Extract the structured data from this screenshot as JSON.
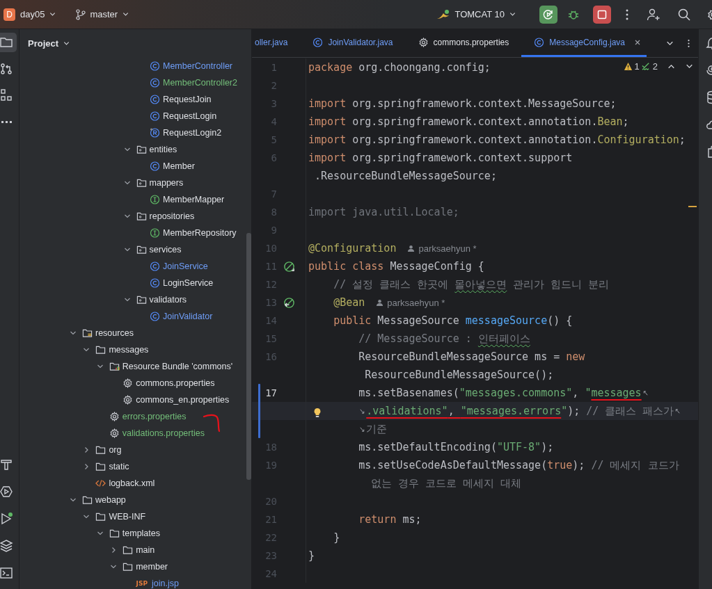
{
  "toolbar": {
    "project": {
      "initial": "D",
      "name": "day05"
    },
    "branch": "master",
    "run_config": "TOMCAT 10"
  },
  "left_tools": [
    {
      "kind": "project",
      "selected": true
    },
    {
      "kind": "commit",
      "selected": false
    },
    {
      "kind": "structure",
      "selected": false
    },
    {
      "kind": "more",
      "selected": false
    }
  ],
  "left_tools_bottom": [
    {
      "kind": "build",
      "selected": false
    },
    {
      "kind": "services",
      "selected": false
    },
    {
      "kind": "run",
      "selected": false
    },
    {
      "kind": "layers",
      "selected": false
    },
    {
      "kind": "terminal",
      "selected": false
    }
  ],
  "project_panel": {
    "title": "Project",
    "tree": [
      {
        "children": [
          {
            "children": [
              {
                "children": [
                  {
                    "children": [
                      {
                        "children": [
                          {
                            "label": "MemberController",
                            "kind": "class",
                            "color": "#6f9ef8"
                          },
                          {
                            "label": "MemberController2",
                            "kind": "class",
                            "color": "#73bd79"
                          },
                          {
                            "label": "RequestJoin",
                            "kind": "class",
                            "color": "#dfe1e5"
                          },
                          {
                            "label": "RequestLogin",
                            "kind": "class",
                            "color": "#dfe1e5"
                          },
                          {
                            "label": "RequestLogin2",
                            "kind": "record",
                            "color": "#dfe1e5"
                          }
                        ]
                      },
                      {
                        "label": "entities",
                        "kind": "package",
                        "color": "#dfe1e5",
                        "expanded": true,
                        "children": [
                          {
                            "label": "Member",
                            "kind": "class",
                            "color": "#dfe1e5"
                          }
                        ]
                      },
                      {
                        "label": "mappers",
                        "kind": "package",
                        "color": "#dfe1e5",
                        "expanded": true,
                        "children": [
                          {
                            "label": "MemberMapper",
                            "kind": "interface",
                            "color": "#dfe1e5"
                          }
                        ]
                      },
                      {
                        "label": "repositories",
                        "kind": "package",
                        "color": "#dfe1e5",
                        "expanded": true,
                        "children": [
                          {
                            "label": "MemberRepository",
                            "kind": "interface",
                            "color": "#dfe1e5"
                          }
                        ]
                      },
                      {
                        "label": "services",
                        "kind": "package",
                        "color": "#dfe1e5",
                        "expanded": true,
                        "children": [
                          {
                            "label": "JoinService",
                            "kind": "class",
                            "color": "#6f9ef8"
                          },
                          {
                            "label": "LoginService",
                            "kind": "class",
                            "color": "#dfe1e5"
                          }
                        ]
                      },
                      {
                        "label": "validators",
                        "kind": "package",
                        "color": "#dfe1e5",
                        "expanded": true,
                        "children": [
                          {
                            "label": "JoinValidator",
                            "kind": "class",
                            "color": "#6f9ef8"
                          }
                        ]
                      }
                    ]
                  }
                ]
              }
            ]
          }
        ]
      },
      {
        "label": "resources",
        "kind": "resources",
        "color": "#dfe1e5",
        "expanded": true,
        "children": [
          {
            "label": "messages",
            "kind": "folder",
            "color": "#dfe1e5",
            "expanded": true,
            "children": [
              {
                "label": "Resource Bundle 'commons'",
                "kind": "bundle",
                "color": "#dfe1e5",
                "expanded": true,
                "children": [
                  {
                    "label": "commons.properties",
                    "kind": "properties",
                    "color": "#dfe1e5"
                  },
                  {
                    "label": "commons_en.properties",
                    "kind": "properties",
                    "color": "#dfe1e5"
                  }
                ]
              },
              {
                "label": "errors.properties",
                "kind": "properties",
                "color": "#73bd79"
              },
              {
                "label": "validations.properties",
                "kind": "properties",
                "color": "#73bd79"
              }
            ]
          },
          {
            "label": "org",
            "kind": "folder",
            "color": "#dfe1e5",
            "expanded": false
          },
          {
            "label": "static",
            "kind": "folder",
            "color": "#dfe1e5",
            "expanded": false
          },
          {
            "label": "logback.xml",
            "kind": "xml",
            "color": "#dfe1e5"
          }
        ]
      },
      {
        "label": "webapp",
        "kind": "folder",
        "color": "#dfe1e5",
        "expanded": true,
        "children": [
          {
            "label": "WEB-INF",
            "kind": "folder",
            "color": "#dfe1e5",
            "expanded": true,
            "children": [
              {
                "label": "templates",
                "kind": "folder",
                "color": "#dfe1e5",
                "expanded": true,
                "children": [
                  {
                    "label": "main",
                    "kind": "folder",
                    "color": "#dfe1e5",
                    "expanded": false
                  },
                  {
                    "label": "member",
                    "kind": "folder",
                    "color": "#dfe1e5",
                    "expanded": true,
                    "children": [
                      {
                        "label": "join.jsp",
                        "kind": "jsp",
                        "icon_text": "JSP",
                        "color": "#6f9ef8"
                      }
                    ]
                  }
                ]
              }
            ]
          }
        ]
      }
    ]
  },
  "tabs": [
    {
      "label": "oller.java",
      "color": "#6f9ef8",
      "selected": false
    },
    {
      "label": "JoinValidator.java",
      "kind": "class",
      "color": "#6f9ef8",
      "selected": false
    },
    {
      "label": "commons.properties",
      "kind": "properties",
      "color": "#dfe1e5",
      "selected": false
    },
    {
      "label": "MessageConfig.java",
      "kind": "class",
      "color": "#6f9ef8",
      "selected": true
    }
  ],
  "editor": {
    "warnings": "1",
    "checks": "2",
    "lines": [
      {
        "number": "1",
        "kind": "plain",
        "rows": [
          {
            "tokens": [
              {
                "kind": "kw",
                "text": "package "
              },
              {
                "kind": "plain",
                "text": "org.choongang.config;"
              }
            ]
          }
        ]
      },
      {
        "number": "2",
        "kind": "plain",
        "rows": [
          {}
        ]
      },
      {
        "number": "3",
        "kind": "plain",
        "rows": [
          {
            "tokens": [
              {
                "kind": "kw",
                "text": "import "
              },
              {
                "kind": "plain",
                "text": "org.springframework.context.MessageSource;"
              }
            ]
          }
        ]
      },
      {
        "number": "4",
        "kind": "plain",
        "rows": [
          {
            "tokens": [
              {
                "kind": "kw",
                "text": "import "
              },
              {
                "kind": "plain",
                "text": "org.springframework.context.annotation."
              },
              {
                "kind": "ann",
                "text": "Bean"
              },
              {
                "kind": "plain",
                "text": ";"
              }
            ]
          }
        ]
      },
      {
        "number": "5",
        "kind": "plain",
        "rows": [
          {
            "tokens": [
              {
                "kind": "kw",
                "text": "import "
              },
              {
                "kind": "plain",
                "text": "org.springframework.context.annotation."
              },
              {
                "kind": "ann",
                "text": "Configuration"
              },
              {
                "kind": "plain",
                "text": ";"
              }
            ]
          }
        ]
      },
      {
        "number": "6",
        "kind": "plain",
        "rows": [
          {
            "tokens": [
              {
                "kind": "kw",
                "text": "import "
              },
              {
                "kind": "plain",
                "text": "org.springframework.context.support"
              }
            ]
          },
          {
            "tokens": [
              {
                "kind": "plain",
                "text": " .ResourceBundleMessageSource;"
              }
            ]
          }
        ]
      },
      {
        "number": "7",
        "kind": "plain",
        "rows": [
          {}
        ]
      },
      {
        "number": "8",
        "kind": "plain",
        "rows": [
          {
            "tokens": [
              {
                "kind": "dim",
                "text": "import java.util.Locale;"
              }
            ]
          }
        ]
      },
      {
        "number": "9",
        "kind": "plain",
        "rows": [
          {}
        ]
      },
      {
        "number": "10",
        "kind": "plain",
        "rows": [
          {
            "tokens": [
              {
                "kind": "ann",
                "text": "@Configuration"
              }
            ],
            "author": "parksaehyun *"
          }
        ]
      },
      {
        "number": "11",
        "kind": "bean",
        "rows": [
          {
            "tokens": [
              {
                "kind": "kw",
                "text": "public class "
              },
              {
                "kind": "plain",
                "text": "MessageConfig {"
              }
            ]
          }
        ]
      },
      {
        "number": "12",
        "kind": "plain",
        "rows": [
          {
            "tokens": [
              {
                "kind": "cmt",
                "text": "    // 설정 클래스 한곳에 "
              },
              {
                "kind": "cmt",
                "text": "몰아넣으면",
                "typo": true
              },
              {
                "kind": "cmt",
                "text": " 관리가 힘드니 분리"
              }
            ]
          }
        ]
      },
      {
        "number": "13",
        "kind": "bean-method",
        "rows": [
          {
            "tokens": [
              {
                "kind": "ann",
                "text": "    @Bean"
              }
            ],
            "author": "parksaehyun *"
          }
        ]
      },
      {
        "number": "14",
        "kind": "plain",
        "rows": [
          {
            "tokens": [
              {
                "kind": "kw",
                "text": "    public "
              },
              {
                "kind": "plain",
                "text": "MessageSource "
              },
              {
                "kind": "fn",
                "text": "messageSource"
              },
              {
                "kind": "plain",
                "text": "() {"
              }
            ]
          }
        ]
      },
      {
        "number": "15",
        "kind": "plain",
        "rows": [
          {
            "tokens": [
              {
                "kind": "cmt",
                "text": "        // MessageSource : "
              },
              {
                "kind": "cmt",
                "text": "인터페이스",
                "typo": true
              }
            ]
          }
        ]
      },
      {
        "number": "16",
        "kind": "plain",
        "rows": [
          {
            "tokens": [
              {
                "kind": "plain",
                "text": "        ResourceBundleMessageSource ms = "
              },
              {
                "kind": "kw",
                "text": "new"
              }
            ]
          },
          {
            "tokens": [
              {
                "kind": "plain",
                "text": "         ResourceBundleMessageSource();"
              }
            ]
          }
        ]
      },
      {
        "number": "17",
        "kind": "plain",
        "current": true,
        "changed": true,
        "rows": [
          {
            "tokens": [
              {
                "kind": "plain",
                "text": "        ms.setBasenames("
              },
              {
                "kind": "str",
                "text": "\"messages.commons\""
              },
              {
                "kind": "plain",
                "text": ", "
              },
              {
                "kind": "str",
                "text": "\""
              },
              {
                "kind": "str",
                "text": "messages",
                "marked": true
              }
            ],
            "wrap_end": true,
            "caret": false
          },
          {
            "tokens": [
              {
                "kind": "str",
                "text": "        .validations\"",
                "marked": true
              },
              {
                "kind": "plain",
                "text": ", ",
                "marked": true
              },
              {
                "kind": "str",
                "text": "\"messages.errors",
                "marked": true
              },
              {
                "kind": "str",
                "text": "\""
              },
              {
                "kind": "plain",
                "text": "); "
              },
              {
                "kind": "cmt",
                "text": "// 클래스 패스가"
              }
            ],
            "wrap_start": true,
            "wrap_end": true,
            "caret": true,
            "bulb": true
          },
          {
            "tokens": [
              {
                "kind": "cmt",
                "text": "        기준"
              }
            ],
            "wrap_start": true,
            "caret": false
          }
        ]
      },
      {
        "number": "18",
        "kind": "plain",
        "rows": [
          {
            "tokens": [
              {
                "kind": "plain",
                "text": "        ms.setDefaultEncoding("
              },
              {
                "kind": "str",
                "text": "\"UTF-8\""
              },
              {
                "kind": "plain",
                "text": ");"
              }
            ]
          }
        ]
      },
      {
        "number": "19",
        "kind": "plain",
        "rows": [
          {
            "tokens": [
              {
                "kind": "plain",
                "text": "        ms.setUseCodeAsDefaultMessage("
              },
              {
                "kind": "kw",
                "text": "true"
              },
              {
                "kind": "plain",
                "text": "); "
              },
              {
                "kind": "cmt",
                "text": "// 메세지 코드가"
              }
            ]
          },
          {
            "tokens": [
              {
                "kind": "cmt",
                "text": "          없는 경우 코드로 메세지 대체"
              }
            ]
          }
        ]
      },
      {
        "number": "20",
        "kind": "plain",
        "rows": [
          {}
        ]
      },
      {
        "number": "21",
        "kind": "plain",
        "rows": [
          {
            "tokens": [
              {
                "kind": "kw",
                "text": "        return "
              },
              {
                "kind": "plain",
                "text": "ms;"
              }
            ]
          }
        ]
      },
      {
        "number": "22",
        "kind": "plain",
        "rows": [
          {
            "tokens": [
              {
                "kind": "plain",
                "text": "    }"
              }
            ]
          }
        ]
      },
      {
        "number": "23",
        "kind": "plain",
        "rows": [
          {
            "tokens": [
              {
                "kind": "plain",
                "text": "}"
              }
            ]
          }
        ]
      },
      {
        "number": "24",
        "kind": "plain",
        "rows": [
          {}
        ]
      }
    ]
  }
}
